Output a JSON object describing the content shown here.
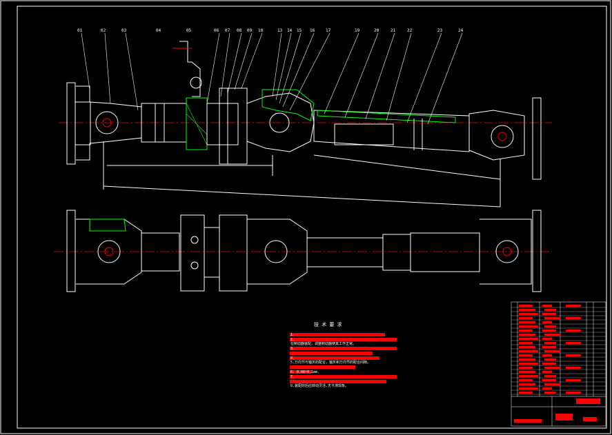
{
  "drawing": {
    "part_labels": [
      "01",
      "02",
      "03",
      "04",
      "05",
      "06",
      "07",
      "08",
      "09",
      "10",
      "13",
      "14",
      "15",
      "16",
      "17",
      "19",
      "20",
      "21",
      "22",
      "23",
      "24"
    ],
    "dimensions": {
      "d1": "",
      "d2": "",
      "d3": ""
    },
    "tech_requirements": {
      "title": "技 术 要 求",
      "lines": [
        "1.",
        "2.",
        "  在制动器装配，调整制动器使其工作正常。",
        "3.",
        "",
        "4.",
        "5.万向节与轴叉的配合，轴叉和万向节的配合间隙。",
        "",
        "6.               0.08~0.1mm.",
        "7.",
        "",
        "8.装配好后应转动灵活,无卡滞现象。"
      ]
    },
    "colors": {
      "line": "#ffffff",
      "red": "#ff0000",
      "green": "#00ff00",
      "center": "#ff0000",
      "dim": "#ffffff"
    }
  }
}
